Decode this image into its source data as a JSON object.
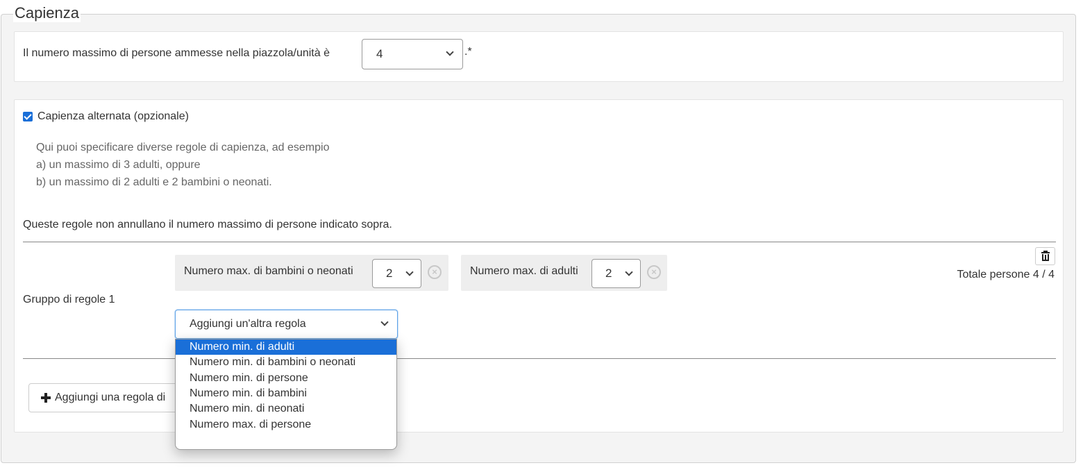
{
  "legend": "Capienza",
  "max_persons": {
    "label": "Il numero massimo di persone ammesse nella piazzola/unità è",
    "value": "4",
    "suffix": ".*"
  },
  "alt_capacity": {
    "checked": true,
    "label": "Capienza alternata (opzionale)",
    "help_lines": [
      "Qui puoi specificare diverse regole di capienza, ad esempio",
      "a) un massimo di 3 adulti, oppure",
      "b) un massimo di 2 adulti e 2 bambini o neonati."
    ],
    "note": "Queste regole non annullano il numero massimo di persone indicato sopra."
  },
  "rule_group": {
    "label": "Gruppo di regole 1",
    "total": "Totale persone 4 / 4",
    "rules": [
      {
        "label": "Numero max. di bambini o neonati",
        "value": "2"
      },
      {
        "label": "Numero max. di adulti",
        "value": "2"
      }
    ],
    "add_rule_placeholder": "Aggiungi un'altra regola",
    "add_rule_options": [
      "Numero min. di adulti",
      "Numero min. di bambini o neonati",
      "Numero min. di persone",
      "Numero min. di bambini",
      "Numero min. di neonati",
      "Numero max. di persone"
    ],
    "highlighted_option": "Numero min. di adulti"
  },
  "add_group_button": "Aggiungi una regola di"
}
